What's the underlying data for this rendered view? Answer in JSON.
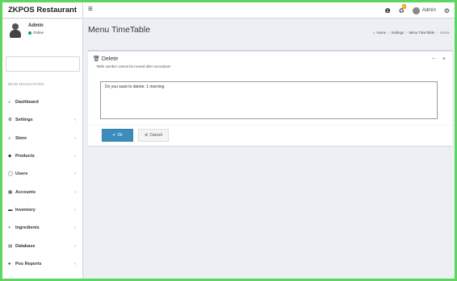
{
  "app": {
    "brand": "ZKPOS Restaurant"
  },
  "topbar": {
    "menu_icon": "≡",
    "info_icon": "❶",
    "bell_count": "0",
    "user_label": "Admin",
    "settings_icon": "⚙"
  },
  "sidebar": {
    "user": {
      "name": "Admin",
      "status": "Online"
    },
    "nav_header": "MAIN NAVIGATION",
    "items": [
      {
        "label": "Dashboard",
        "icon": "⌂",
        "icon_name": "dashboard-icon",
        "has_chevron": false
      },
      {
        "label": "Settings",
        "icon": "⚙",
        "icon_name": "gear-icon",
        "has_chevron": true
      },
      {
        "label": "Store",
        "icon": "⌂",
        "icon_name": "home-icon",
        "has_chevron": true
      },
      {
        "label": "Products",
        "icon": "◆",
        "icon_name": "products-icon",
        "has_chevron": true
      },
      {
        "label": "Users",
        "icon": "◯",
        "icon_name": "user-icon",
        "has_chevron": true
      },
      {
        "label": "Accounts",
        "icon": "▦",
        "icon_name": "accounts-icon",
        "has_chevron": true
      },
      {
        "label": "Inventory",
        "icon": "▬",
        "icon_name": "inventory-icon",
        "has_chevron": true
      },
      {
        "label": "Ingredients",
        "icon": "+",
        "icon_name": "plus-icon",
        "has_chevron": true
      },
      {
        "label": "Database",
        "icon": "▤",
        "icon_name": "database-icon",
        "has_chevron": true
      },
      {
        "label": "Pos Reports",
        "icon": "●",
        "icon_name": "reports-icon",
        "has_chevron": true
      }
    ]
  },
  "content": {
    "page_title": "Menu TimeTable",
    "breadcrumb": [
      "Home",
      "Settings",
      "Menu TimeTable",
      "Delete"
    ]
  },
  "dialog": {
    "title": "Delete",
    "subtitle": "Table number cannot be reused after revocation!",
    "textarea_value": "Do you want to delete: 1 morning",
    "ok_label": "Ok",
    "cancel_label": "Cancel"
  },
  "colors": {
    "primary": "#3c8dbc",
    "online": "#00a65a",
    "badge": "#f39c12",
    "frame_border": "#5cd65c"
  }
}
